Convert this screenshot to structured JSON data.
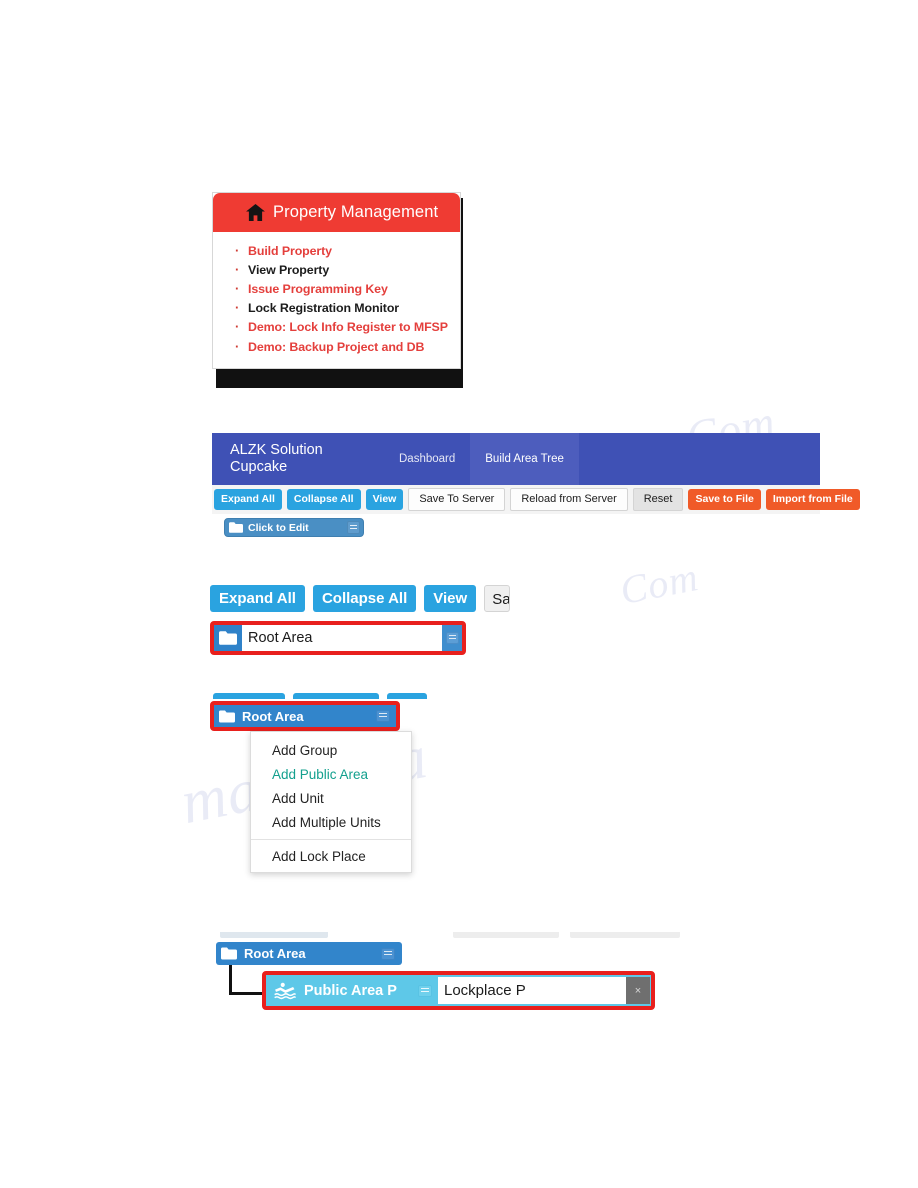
{
  "watermarks": {
    "a": "chive. Com",
    "b": "manualsa",
    "c": "Com"
  },
  "property_card": {
    "header": {
      "icon": "home-icon",
      "title": "Property Management"
    },
    "items": [
      {
        "label": "Build Property",
        "color": "#e43f3c",
        "style": "red"
      },
      {
        "label": "View Property",
        "color": "#1c1c1c",
        "style": "dark"
      },
      {
        "label": "Issue Programming Key",
        "color": "#e43f3c",
        "style": "red"
      },
      {
        "label": "Lock Registration Monitor",
        "color": "#1c1c1c",
        "style": "dark"
      },
      {
        "label": "Demo: Lock Info Register to MFSP",
        "color": "#e43f3c",
        "style": "red"
      },
      {
        "label": "Demo: Backup Project and DB",
        "color": "#e43f3c",
        "style": "red"
      }
    ],
    "bullet": "·"
  },
  "app": {
    "navbar": {
      "brand_line1": "ALZK Solution",
      "brand_line2": "Cupcake",
      "background": "#3f51b5",
      "tabs": [
        {
          "label": "Dashboard",
          "active": false
        },
        {
          "label": "Build Area Tree",
          "active": true
        }
      ]
    },
    "toolbar": {
      "expand_all": "Expand All",
      "collapse_all": "Collapse All",
      "view": "View",
      "save_to_server": "Save To Server",
      "reload_from_server": "Reload from Server",
      "reset": "Reset",
      "save_to_file": "Save to File",
      "import_from_file": "Import from File",
      "blue": "#2aa3e0",
      "orange": "#f05a28"
    },
    "tree": {
      "placeholder_node": "Click to Edit",
      "folder_icon": "folder-icon",
      "menu_icon": "hamburger-menu-icon"
    }
  },
  "edit_figure": {
    "buttons": {
      "expand_all": "Expand All",
      "collapse_all": "Collapse All",
      "view": "View",
      "save_truncated": "Sav"
    },
    "node": {
      "folder_icon": "folder-icon",
      "value": "Root Area",
      "placeholder": "Root Area",
      "menu_icon": "hamburger-menu-icon"
    },
    "highlight_color": "#e8201d"
  },
  "menu_figure": {
    "node": {
      "folder_icon": "folder-icon",
      "label": "Root Area",
      "menu_icon": "hamburger-menu-icon"
    },
    "menu_items": [
      {
        "label": "Add Group",
        "highlight": false
      },
      {
        "label": "Add Public Area",
        "highlight": true
      },
      {
        "label": "Add Unit",
        "highlight": false
      },
      {
        "label": "Add Multiple Units",
        "highlight": false
      },
      {
        "label": "Add Lock Place",
        "highlight": false,
        "after_separator": true
      }
    ],
    "highlight_text_color": "#13a08e",
    "highlight_color": "#e8201d"
  },
  "child_figure": {
    "root": {
      "folder_icon": "folder-icon",
      "label": "Root Area",
      "menu_icon": "hamburger-menu-icon"
    },
    "public_area": {
      "pool_icon": "swimmer-pool-icon",
      "label": "Public Area P",
      "menu_icon": "hamburger-menu-icon",
      "input_value": "Lockplace P",
      "input_placeholder": "Lockplace P",
      "close_label": "×",
      "background": "#5ec8e8"
    },
    "highlight_color": "#e8201d"
  }
}
